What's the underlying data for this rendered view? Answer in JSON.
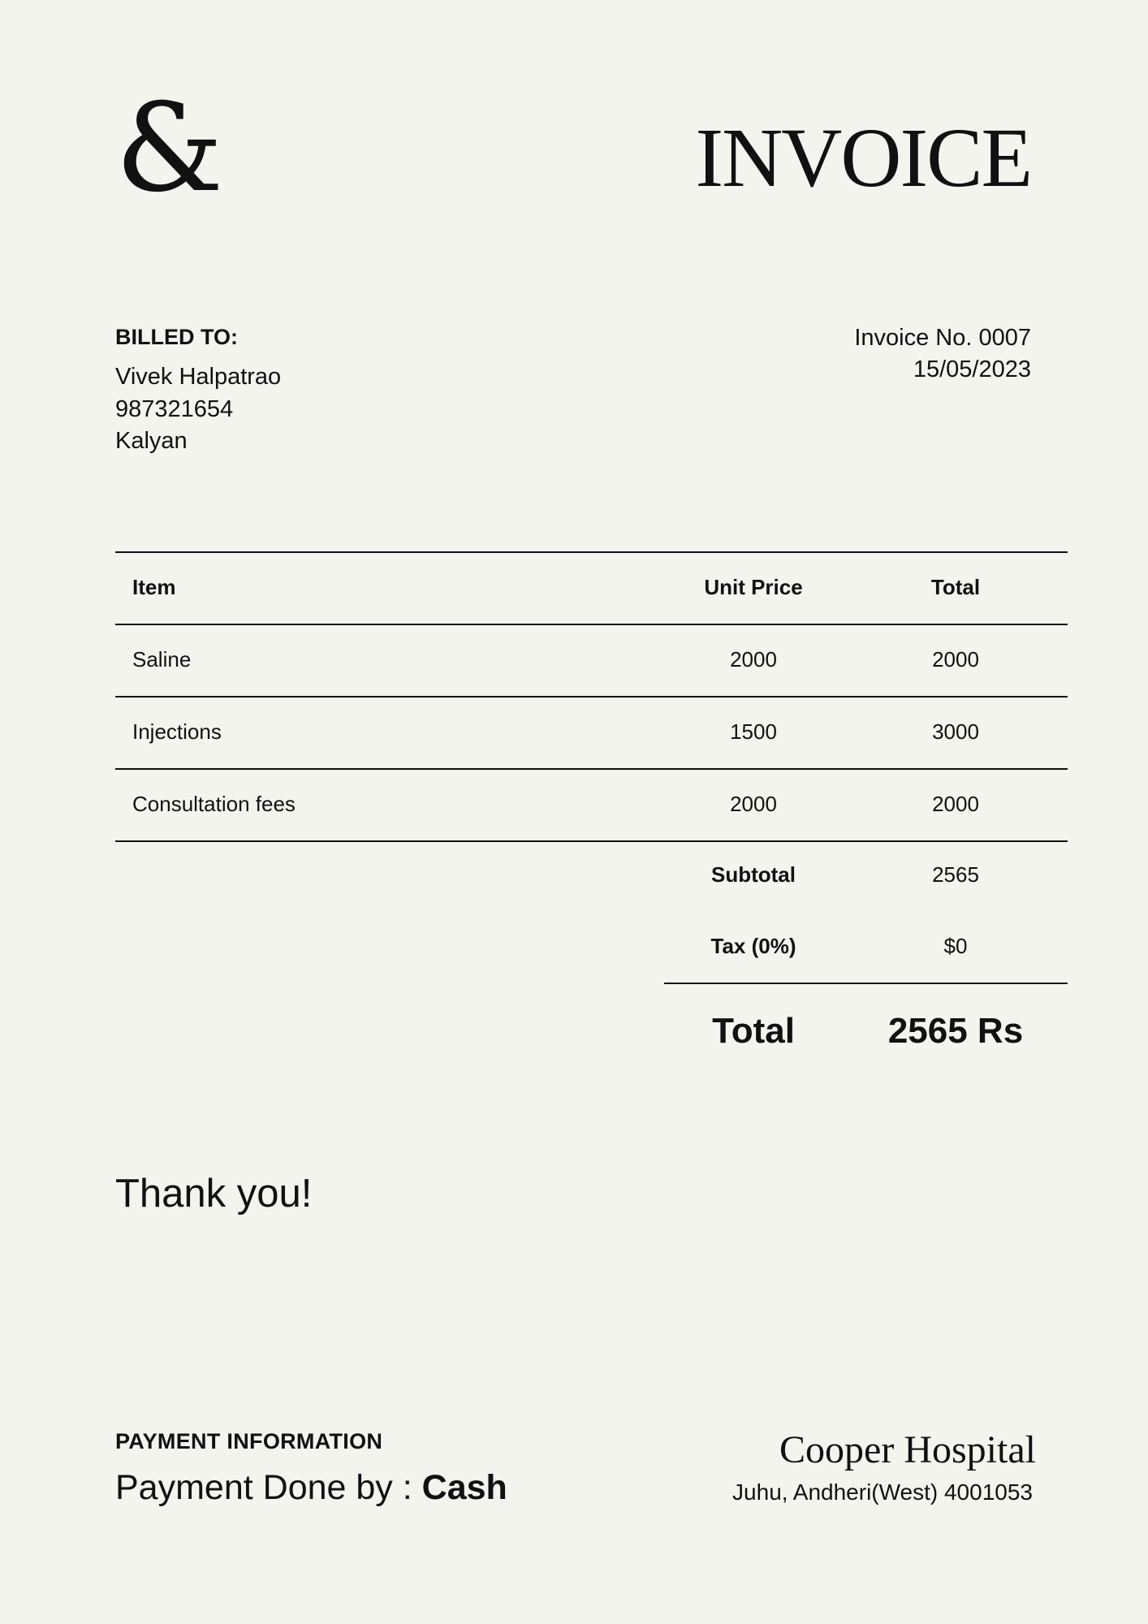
{
  "header": {
    "logo_glyph": "&",
    "title": "INVOICE"
  },
  "billed_to": {
    "heading": "BILLED TO:",
    "name": "Vivek Halpatrao",
    "phone": "987321654",
    "city": "Kalyan"
  },
  "invoice_meta": {
    "number": "Invoice No. 0007",
    "date": "15/05/2023"
  },
  "table": {
    "headers": {
      "item": "Item",
      "unit_price": "Unit Price",
      "total": "Total"
    },
    "rows": [
      {
        "item": "Saline",
        "unit_price": "2000",
        "total": "2000"
      },
      {
        "item": "Injections",
        "unit_price": "1500",
        "total": "3000"
      },
      {
        "item": "Consultation fees",
        "unit_price": "2000",
        "total": "2000"
      }
    ]
  },
  "summary": {
    "subtotal_label": "Subtotal",
    "subtotal_value": "2565",
    "tax_label": "Tax (0%)",
    "tax_value": "$0",
    "total_label": "Total",
    "total_value": "2565 Rs"
  },
  "thanks": "Thank you!",
  "payment": {
    "heading": "PAYMENT INFORMATION",
    "prefix": "Payment Done by : ",
    "method": "Cash"
  },
  "issuer": {
    "name": "Cooper Hospital",
    "address": "Juhu, Andheri(West) 4001053"
  }
}
